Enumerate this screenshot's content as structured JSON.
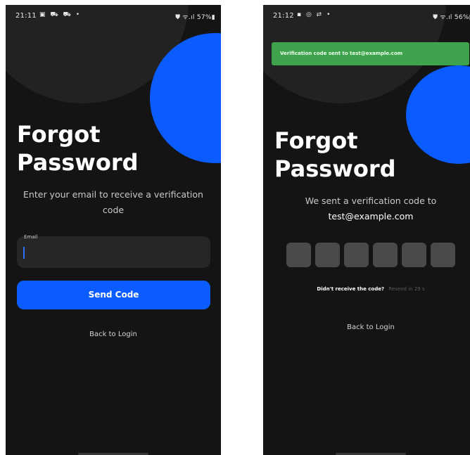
{
  "screens": [
    {
      "status_bar": {
        "time": "21:11",
        "left_icons": "▣ ⛟ ⛟ •",
        "right": "⛊ ᯤ.ıl 57%▮"
      },
      "title_line1": "Forgot",
      "title_line2": "Password",
      "subtitle_line1": "Enter your email to receive a verification",
      "subtitle_line2": "code",
      "email_label": "Email",
      "email_value": "",
      "send_button_label": "Send Code",
      "back_link_label": "Back to Login"
    },
    {
      "status_bar": {
        "time": "21:12",
        "left_icons": "▪ ◎ ⇄ •",
        "right": "⛊ ᯤ.ıl 56%▮"
      },
      "toast_message": "Verification code sent to test@example.com",
      "title_line1": "Forgot",
      "title_line2": "Password",
      "subtitle_line1": "We sent a verification code to",
      "subtitle_email": "test@example.com",
      "code_digits": [
        "",
        "",
        "",
        "",
        "",
        ""
      ],
      "resend_question": "Didn't receive the code?",
      "resend_timer": "Resend in 29 s",
      "back_link_label": "Back to Login"
    }
  ],
  "colors": {
    "background": "#141414",
    "accent_blue": "#0a5cff",
    "toast_green": "#3fa34d",
    "input_bg": "#262626",
    "code_box": "#4a4a4a"
  },
  "icons": [
    "gallery-icon",
    "car-icon",
    "wifi-icon",
    "signal-icon",
    "battery-icon",
    "alarm-icon"
  ]
}
